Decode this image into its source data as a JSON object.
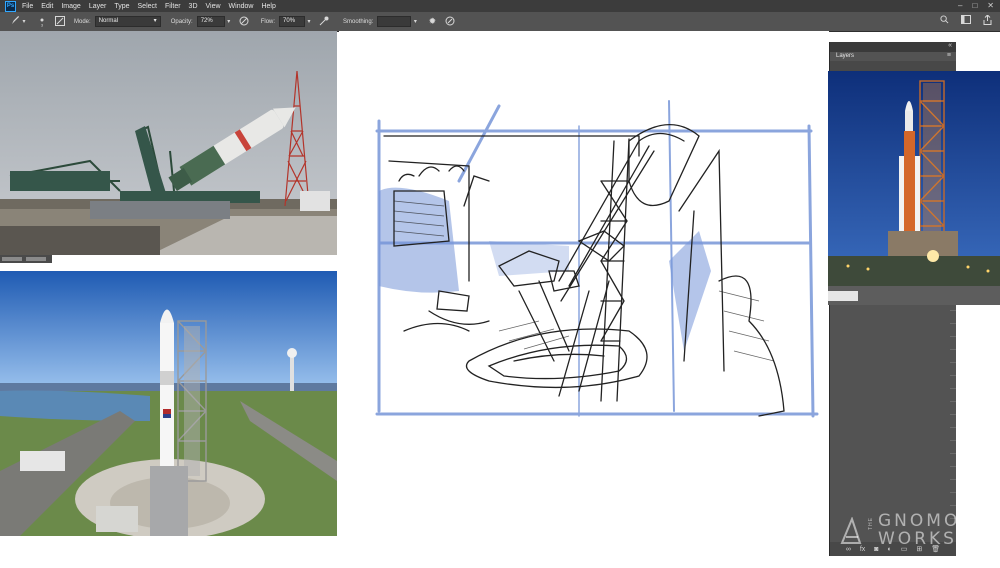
{
  "app": {
    "logo": "Ps",
    "menu": [
      "File",
      "Edit",
      "Image",
      "Layer",
      "Type",
      "Select",
      "Filter",
      "3D",
      "View",
      "Window",
      "Help"
    ]
  },
  "options": {
    "mode_label": "Mode:",
    "mode_value": "Normal",
    "opacity_label": "Opacity:",
    "opacity_value": "72%",
    "flow_label": "Flow:",
    "flow_value": "70%",
    "smoothing_label": "Smoothing:"
  },
  "panel": {
    "layers_tab": "Layers"
  },
  "watermark": {
    "the": "THE",
    "line1": "GNOMON",
    "line2": "WORKSHOP"
  },
  "colors": {
    "menubar": "#3c3c3c",
    "toolbar": "#535353",
    "panel": "#535353",
    "sketch_blue": "#6f8fd6",
    "sketch_ink": "#222222"
  },
  "icons": {
    "brush": "brush-icon",
    "pressure": "pressure-opacity-icon",
    "airbrush": "airbrush-icon",
    "gear": "gear-icon",
    "search": "search-icon",
    "workspace": "workspace-icon",
    "share": "share-icon"
  }
}
